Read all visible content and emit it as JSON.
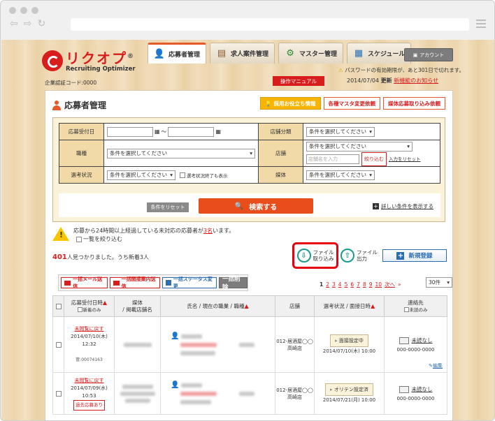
{
  "header": {
    "logo_kana": "リクオプ",
    "logo_registered": "®",
    "logo_subtitle": "Recruiting Optimizer",
    "company_code": "企業認証コード:0000",
    "tabs": [
      {
        "label": "応募者管理",
        "icon": "person-icon"
      },
      {
        "label": "求人案件管理",
        "icon": "book-icon"
      },
      {
        "label": "マスター管理",
        "icon": "gear-icon"
      },
      {
        "label": "スケジュール",
        "icon": "calendar-icon"
      }
    ],
    "account_label": "アカウント",
    "password_notice": "パスワードの有効期限が、あと301日で切れます。",
    "manual_label": "操作マニュアル",
    "update_date": "2014/07/04",
    "update_label": "更新",
    "news_link": "新機能のお知らせ"
  },
  "page": {
    "title": "応募者管理",
    "buttons": {
      "recruit_info": "採用お役立ち情報",
      "master_change": "各種マスタ変更依頼",
      "media_import": "媒体応募取り込み依頼"
    }
  },
  "search": {
    "fields": {
      "date_label": "応募受付日",
      "date_sep": "〜",
      "store_class_label": "店舗分類",
      "job_label": "職種",
      "store_label": "店舗",
      "status_label": "選考状況",
      "media_label": "媒体",
      "select_placeholder": "条件を選択してください",
      "store_name_placeholder": "店舗名を入力",
      "narrow_label": "絞り込む",
      "input_reset": "入力をリセット",
      "include_finished": "選考状況終了も表示"
    },
    "reset_label": "条件をリセット",
    "search_label": "検索する",
    "detail_link": "詳しい条件を表示する"
  },
  "alert": {
    "text_before": "応募から24時間以上経過している未対応の応募者が",
    "count": "3名",
    "text_after": "います。",
    "filter_label": "一覧を絞り込む"
  },
  "results_summary": {
    "count": "401",
    "text": "人見つかりました。うち新着3人"
  },
  "actions": {
    "file_import": [
      "ファイル",
      "取り込み"
    ],
    "file_export": [
      "ファイル",
      "出力"
    ],
    "new_register": "新規登録",
    "bulk_mail": "一括メール送信",
    "bulk_interview": "一括面接案内送信",
    "bulk_status": "一括ステータス変更",
    "bulk_delete": "一括削除"
  },
  "pager": {
    "pages": [
      "1",
      "2",
      "3",
      "4",
      "5",
      "6",
      "7",
      "8",
      "9",
      "10"
    ],
    "current": "1",
    "next": "次へ",
    "per_page": "30件"
  },
  "table": {
    "headers": {
      "date": "応募受付日時",
      "date_sub": "新着のみ",
      "media": "媒体",
      "media_sub": "/ 掲載店舗名",
      "name": "氏名 / 現在の職業 / 職種",
      "store": "店舗",
      "status": "選考状況 / 面接日時",
      "contact": "連絡先",
      "contact_sub": "未読のみ"
    },
    "rows": [
      {
        "undo_label": "未閲覧に戻す",
        "date": "2014/07/10(木)",
        "time": "12:32",
        "number": "管:00074163",
        "store": "012-居酒屋◯◯高崎店",
        "status": "面接設定中",
        "interview_date": "2014/07/10(木) 10:00",
        "unread": "未読なし",
        "phone": "000-0000-0000",
        "edit": "編集"
      },
      {
        "undo_label": "未閲覧に戻す",
        "date": "2014/07/09(水)",
        "time": "10:53",
        "past": "過去応募あり",
        "store": "012-居酒屋◯◯高崎店",
        "status": "オリテン設定済",
        "interview_date": "2014/07/21(月) 10:00",
        "unread": "未読なし",
        "phone": "000-0000-0000"
      }
    ]
  },
  "colors": {
    "brand_red": "#d81d1d",
    "search_orange": "#e94d1c",
    "accent_yellow": "#f7b500",
    "link_blue": "#2a6db3"
  }
}
